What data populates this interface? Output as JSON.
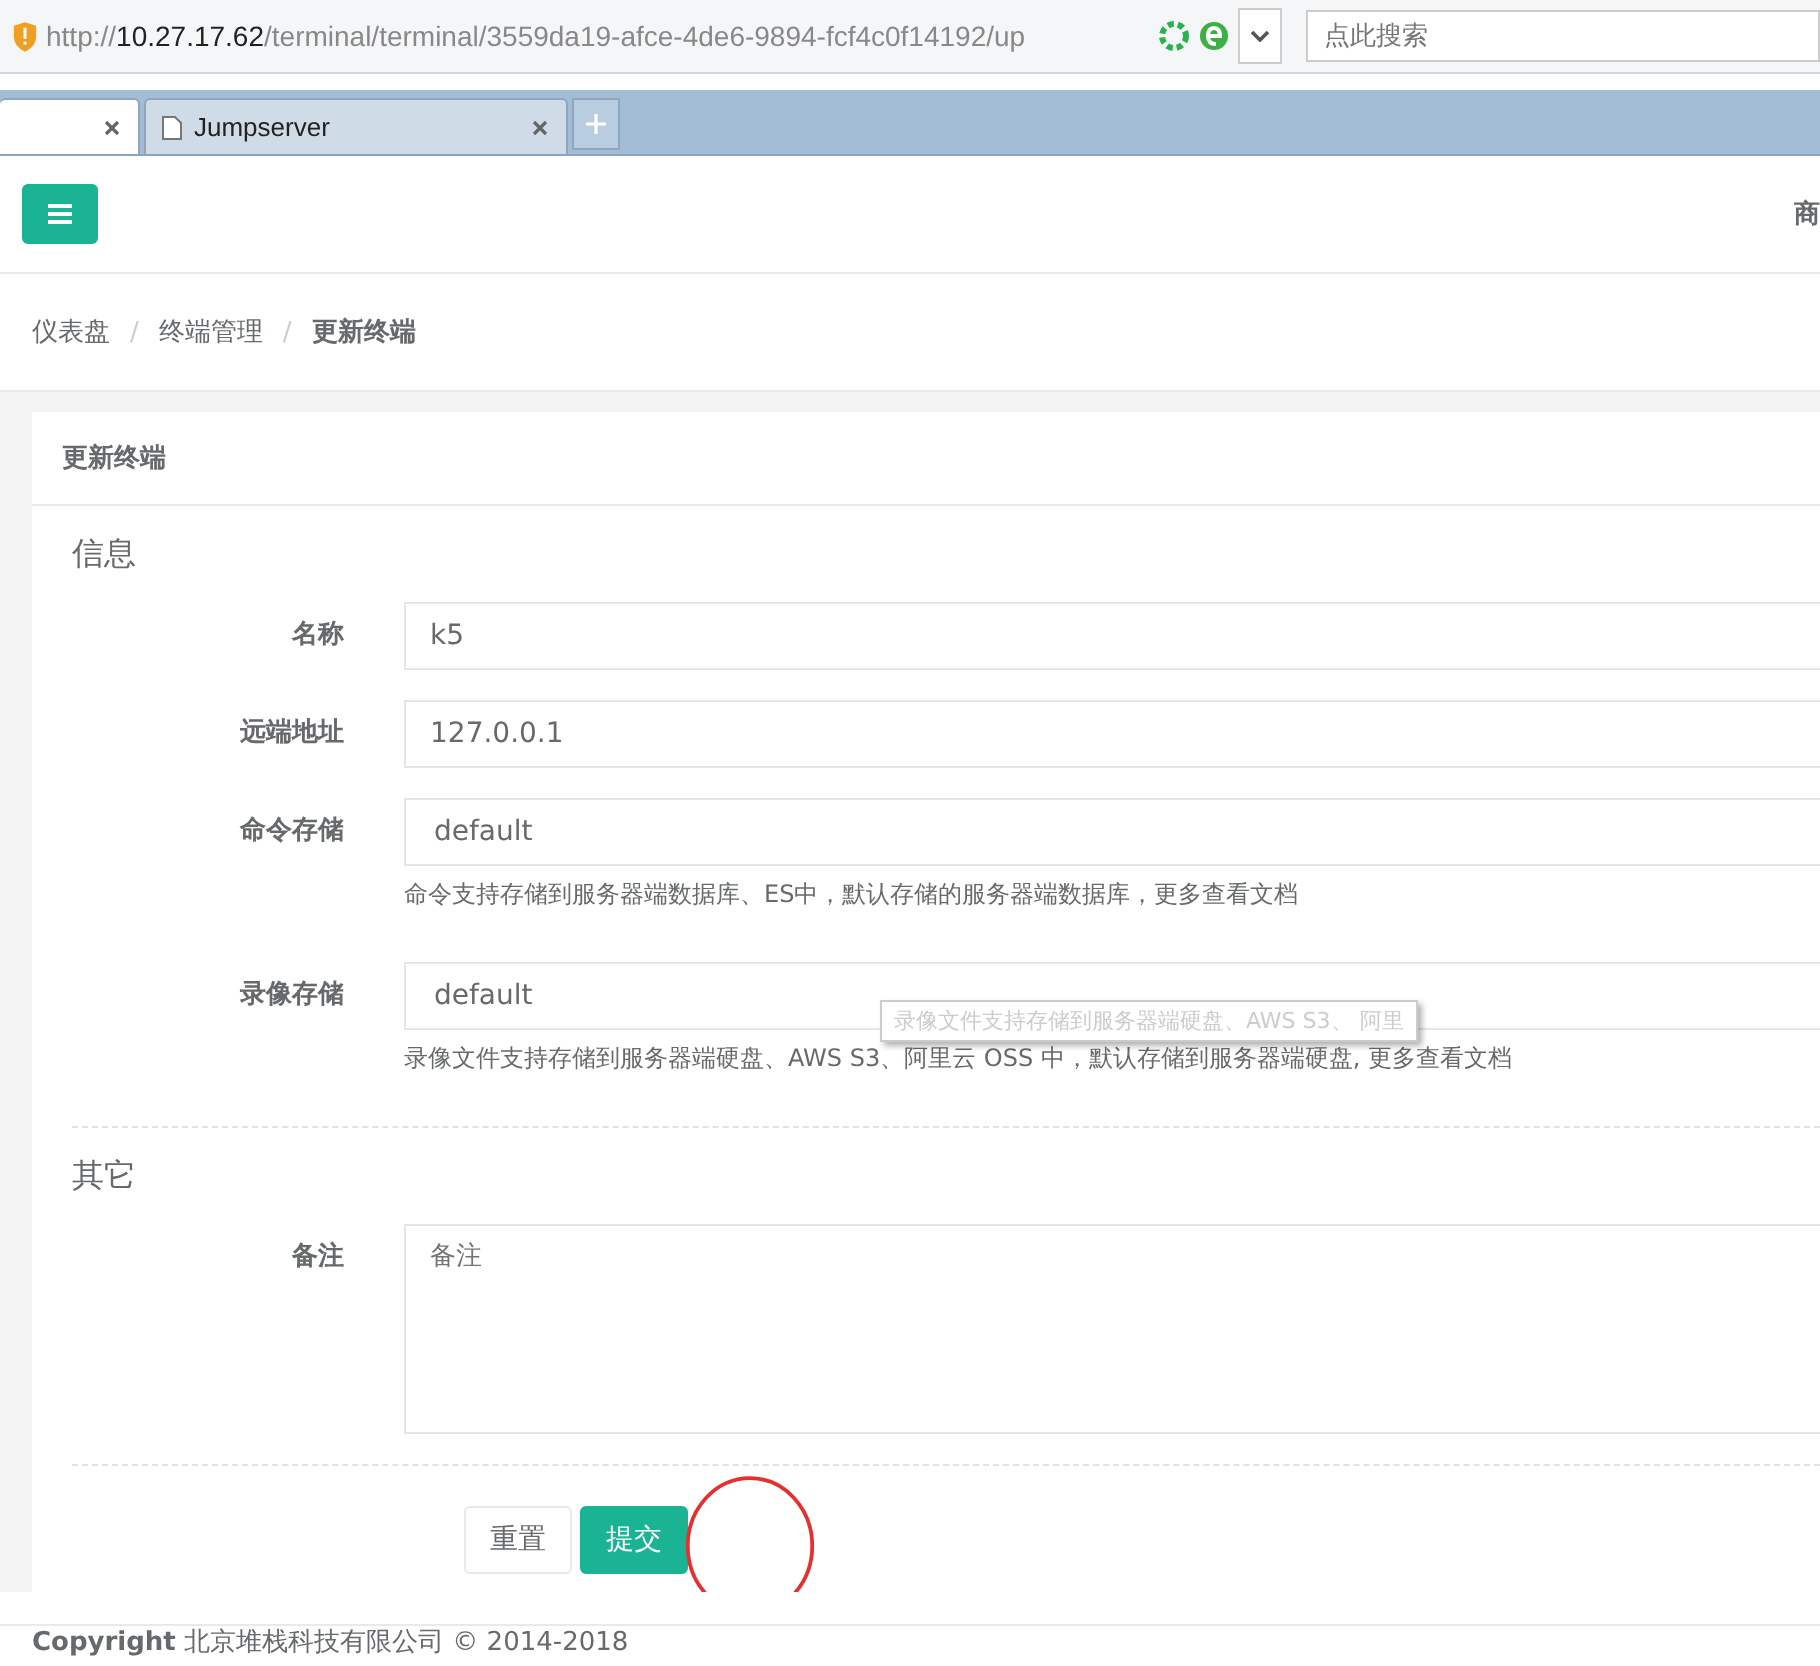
{
  "browser": {
    "url_prefix": "http://",
    "url_host": "10.27.17.62",
    "url_path": "/terminal/terminal/3559da19-afce-4de6-9894-fcf4c0f14192/up",
    "search": {
      "placeholder": "点此搜索"
    },
    "tabs": [
      {
        "selected": true
      },
      {
        "label": "Jumpserver",
        "selected": false
      }
    ]
  },
  "header": {
    "right_text": "商"
  },
  "breadcrumb": {
    "separator": "/",
    "items": [
      {
        "label": "仪表盘",
        "current": false
      },
      {
        "label": "终端管理",
        "current": false
      },
      {
        "label": "更新终端",
        "current": true
      }
    ]
  },
  "card": {
    "title": "更新终端",
    "sections": [
      {
        "title": "信息",
        "fields": [
          {
            "kind": "input",
            "label": "名称",
            "value": "k5"
          },
          {
            "kind": "input",
            "label": "远端地址",
            "value": "127.0.0.1"
          },
          {
            "kind": "select",
            "label": "命令存储",
            "value": "default",
            "help": "命令支持存储到服务器端数据库、ES中，默认存储的服务器端数据库，更多查看文档"
          },
          {
            "kind": "select",
            "label": "录像存储",
            "value": "default",
            "help": "录像文件支持存储到服务器端硬盘、AWS S3、阿里云 OSS 中，默认存储到服务器端硬盘, 更多查看文档",
            "tooltip": "录像文件支持存储到服务器端硬盘、AWS S3、 阿里"
          }
        ]
      },
      {
        "title": "其它",
        "fields": [
          {
            "kind": "textarea",
            "label": "备注",
            "placeholder": "备注"
          }
        ]
      }
    ],
    "buttons": [
      {
        "label": "重置",
        "kind": "default"
      },
      {
        "label": "提交",
        "kind": "primary"
      }
    ]
  },
  "footer": {
    "text": "**Copyright** 北京堆栈科技有限公司 © 2014-2018"
  }
}
